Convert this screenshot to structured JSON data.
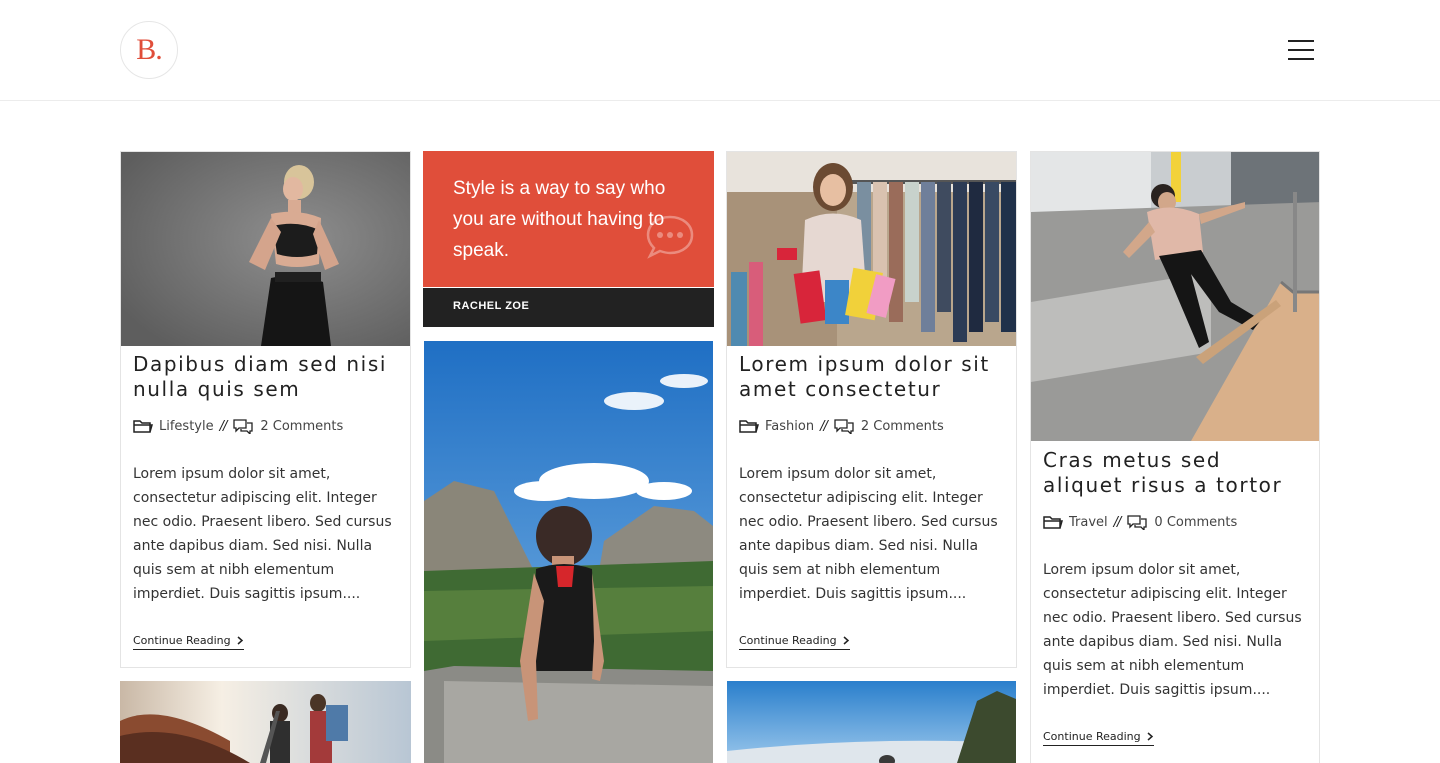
{
  "header": {
    "logo_text": "B.",
    "menu_icon": "hamburger-menu-icon"
  },
  "quote": {
    "text": "Style is a way to say who you are without having to speak.",
    "author": "RACHEL ZOE",
    "icon": "chat-bubble-icon",
    "color": "#e04e3a"
  },
  "posts": [
    {
      "title": "Dapibus diam sed nisi nulla quis sem",
      "category": "Lifestyle",
      "separator": "//",
      "comments": "2 Comments",
      "excerpt": "Lorem ipsum dolor sit amet, consectetur adipiscing elit. Integer nec odio. Praesent libero. Sed cursus ante dapibus diam. Sed nisi. Nulla quis sem at nibh elementum imperdiet. Duis sagittis ipsum....",
      "more": "Continue Reading"
    },
    {
      "title": "Lorem ipsum dolor sit amet consectetur",
      "category": "Fashion",
      "separator": "//",
      "comments": "2 Comments",
      "excerpt": "Lorem ipsum dolor sit amet, consectetur adipiscing elit. Integer nec odio. Praesent libero. Sed cursus ante dapibus diam. Sed nisi. Nulla quis sem at nibh elementum imperdiet. Duis sagittis ipsum....",
      "more": "Continue Reading"
    },
    {
      "title": "Cras metus sed aliquet risus a tortor",
      "category": "Travel",
      "separator": "//",
      "comments": "0 Comments",
      "excerpt": "Lorem ipsum dolor sit amet, consectetur adipiscing elit. Integer nec odio. Praesent libero. Sed cursus ante dapibus diam. Sed nisi. Nulla quis sem at nibh elementum imperdiet. Duis sagittis ipsum....",
      "more": "Continue Reading"
    }
  ],
  "icons": {
    "category": "folder-icon",
    "comments": "comments-icon",
    "more": "chevron-right-icon"
  },
  "colors": {
    "accent": "#e04e3a",
    "dark": "#222222"
  }
}
